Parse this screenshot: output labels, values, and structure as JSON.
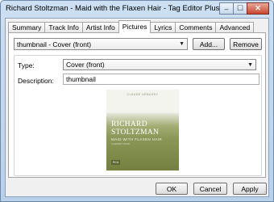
{
  "window": {
    "title": "Richard Stoltzman - Maid with the Flaxen Hair - Tag Editor Plus",
    "minimize": "–",
    "maximize": "☐",
    "close": "✕"
  },
  "tabs": [
    {
      "label": "Summary"
    },
    {
      "label": "Track Info"
    },
    {
      "label": "Artist Info"
    },
    {
      "label": "Pictures",
      "active": true
    },
    {
      "label": "Lyrics"
    },
    {
      "label": "Comments"
    },
    {
      "label": "Advanced"
    }
  ],
  "pictures": {
    "selected": "thumbnail - Cover (front)",
    "add_label": "Add...",
    "remove_label": "Remove",
    "type_label": "Type:",
    "type_value": "Cover (front)",
    "description_label": "Description:",
    "description_value": "thumbnail"
  },
  "cover": {
    "top_text": "CLAUDE DEBUSSY",
    "name_line1": "RICHARD",
    "name_line2": "STOLTZMAN",
    "subtitle": "MAID WITH FLAXEN HAIR",
    "small_text1": "CLARINET MUSIC",
    "small_text2": "",
    "logo": "RCA"
  },
  "footer": {
    "ok_label": "OK",
    "cancel_label": "Cancel",
    "apply_label": "Apply"
  },
  "icons": {
    "dropdown": "chevron-down-icon",
    "grip": "resize-grip-icon"
  }
}
